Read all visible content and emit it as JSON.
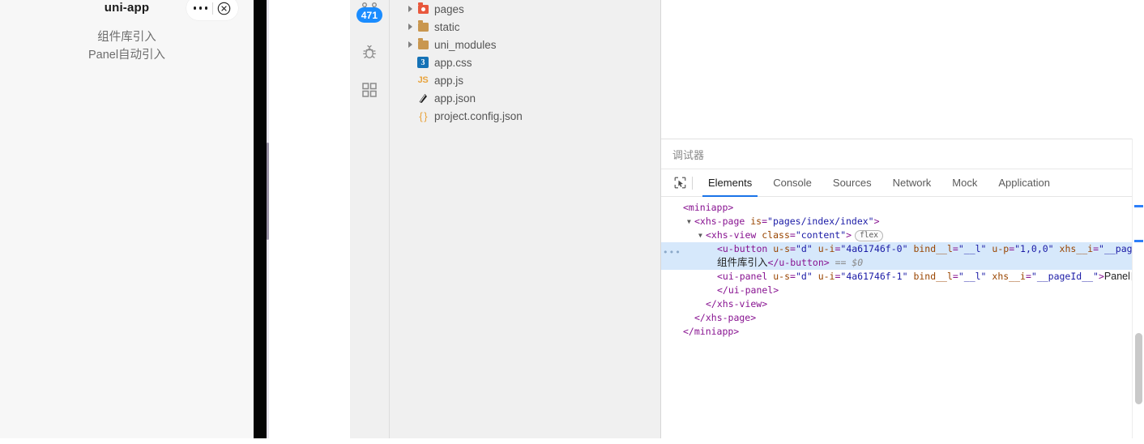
{
  "simulator": {
    "title": "uni-app",
    "capsule": {
      "more_icon": "ellipsis-icon",
      "close_icon": "close-circle-icon"
    },
    "content_lines": [
      "组件库引入",
      "Panel自动引入"
    ]
  },
  "activity_rail": {
    "items": [
      {
        "name": "source-control",
        "icon": "git-branch-icon",
        "badge": "471"
      },
      {
        "name": "debug",
        "icon": "bug-icon",
        "badge": ""
      },
      {
        "name": "extensions",
        "icon": "grid-icon",
        "badge": ""
      }
    ]
  },
  "file_tree": {
    "items": [
      {
        "label": "pages",
        "type": "folder",
        "icon": "folder-pages-icon",
        "expandable": true,
        "expanded": false
      },
      {
        "label": "static",
        "type": "folder",
        "icon": "folder-icon",
        "expandable": true,
        "expanded": false
      },
      {
        "label": "uni_modules",
        "type": "folder",
        "icon": "folder-icon",
        "expandable": true,
        "expanded": false
      },
      {
        "label": "app.css",
        "type": "file",
        "icon": "css-file-icon",
        "expandable": false
      },
      {
        "label": "app.js",
        "type": "file",
        "icon": "js-file-icon",
        "expandable": false
      },
      {
        "label": "app.json",
        "type": "file",
        "icon": "json-app-file-icon",
        "expandable": false
      },
      {
        "label": "project.config.json",
        "type": "file",
        "icon": "braces-file-icon",
        "expandable": false
      }
    ]
  },
  "debugger": {
    "panel_title": "调试器",
    "inspect_icon": "inspect-element-icon",
    "tabs": [
      {
        "label": "Elements",
        "active": true
      },
      {
        "label": "Console",
        "active": false
      },
      {
        "label": "Sources",
        "active": false
      },
      {
        "label": "Network",
        "active": false
      },
      {
        "label": "Mock",
        "active": false
      },
      {
        "label": "Application",
        "active": false
      }
    ],
    "dom": {
      "lines": [
        {
          "indent": 0,
          "arrow": "",
          "parts": [
            {
              "t": "tg",
              "v": "<miniapp>"
            }
          ]
        },
        {
          "indent": 1,
          "arrow": "▼",
          "parts": [
            {
              "t": "tg",
              "v": "<xhs-page "
            },
            {
              "t": "an",
              "v": "is"
            },
            {
              "t": "tg",
              "v": "="
            },
            {
              "t": "av",
              "v": "\"pages/index/index\""
            },
            {
              "t": "tg",
              "v": ">"
            }
          ]
        },
        {
          "indent": 2,
          "arrow": "▼",
          "parts": [
            {
              "t": "tg",
              "v": "<xhs-view "
            },
            {
              "t": "an",
              "v": "class"
            },
            {
              "t": "tg",
              "v": "="
            },
            {
              "t": "av",
              "v": "\"content\""
            },
            {
              "t": "tg",
              "v": ">"
            },
            {
              "t": "badge",
              "v": "flex"
            }
          ]
        },
        {
          "indent": 3,
          "arrow": "",
          "highlight": true,
          "ellipsis": true,
          "parts": [
            {
              "t": "tg",
              "v": "<u-button "
            },
            {
              "t": "an",
              "v": "u-s"
            },
            {
              "t": "tg",
              "v": "="
            },
            {
              "t": "av",
              "v": "\"d\""
            },
            {
              "t": "tg",
              "v": " "
            },
            {
              "t": "an",
              "v": "u-i"
            },
            {
              "t": "tg",
              "v": "="
            },
            {
              "t": "av",
              "v": "\"4a61746f-0\""
            },
            {
              "t": "tg",
              "v": " "
            },
            {
              "t": "an",
              "v": "bind__l"
            },
            {
              "t": "tg",
              "v": "="
            },
            {
              "t": "av",
              "v": "\"__l\""
            },
            {
              "t": "tg",
              "v": " "
            },
            {
              "t": "an",
              "v": "u-p"
            },
            {
              "t": "tg",
              "v": "="
            },
            {
              "t": "av",
              "v": "\"1,0,0\""
            },
            {
              "t": "tg",
              "v": " "
            },
            {
              "t": "an",
              "v": "xhs__i"
            },
            {
              "t": "tg",
              "v": "="
            },
            {
              "t": "av",
              "v": "\"__pageId__\""
            },
            {
              "t": "tg",
              "v": ">"
            }
          ]
        },
        {
          "indent": 3,
          "arrow": "",
          "highlight": true,
          "parts": [
            {
              "t": "txt",
              "v": "组件库引入"
            },
            {
              "t": "tg",
              "v": "</u-button>"
            },
            {
              "t": "sel",
              "v": " == $0"
            }
          ]
        },
        {
          "indent": 3,
          "arrow": "",
          "parts": [
            {
              "t": "tg",
              "v": "<ui-panel "
            },
            {
              "t": "an",
              "v": "u-s"
            },
            {
              "t": "tg",
              "v": "="
            },
            {
              "t": "av",
              "v": "\"d\""
            },
            {
              "t": "tg",
              "v": " "
            },
            {
              "t": "an",
              "v": "u-i"
            },
            {
              "t": "tg",
              "v": "="
            },
            {
              "t": "av",
              "v": "\"4a61746f-1\""
            },
            {
              "t": "tg",
              "v": " "
            },
            {
              "t": "an",
              "v": "bind__l"
            },
            {
              "t": "tg",
              "v": "="
            },
            {
              "t": "av",
              "v": "\"__l\""
            },
            {
              "t": "tg",
              "v": " "
            },
            {
              "t": "an",
              "v": "xhs__i"
            },
            {
              "t": "tg",
              "v": "="
            },
            {
              "t": "av",
              "v": "\"__pageId__\""
            },
            {
              "t": "tg",
              "v": ">"
            },
            {
              "t": "txt",
              "v": "Panel自动引入"
            }
          ]
        },
        {
          "indent": 3,
          "arrow": "",
          "parts": [
            {
              "t": "tg",
              "v": "</ui-panel>"
            }
          ]
        },
        {
          "indent": 2,
          "arrow": "",
          "parts": [
            {
              "t": "tg",
              "v": "</xhs-view>"
            }
          ]
        },
        {
          "indent": 1,
          "arrow": "",
          "parts": [
            {
              "t": "tg",
              "v": "</xhs-page>"
            }
          ]
        },
        {
          "indent": 0,
          "arrow": "",
          "parts": [
            {
              "t": "tg",
              "v": "</miniapp>"
            }
          ]
        }
      ]
    }
  },
  "colors": {
    "accent_blue": "#1a73e8",
    "badge_blue": "#1a8cff",
    "highlight_row": "#d6e8fb",
    "tag_purple": "#881391",
    "attr_name": "#994500",
    "attr_value": "#1a1aa6"
  }
}
